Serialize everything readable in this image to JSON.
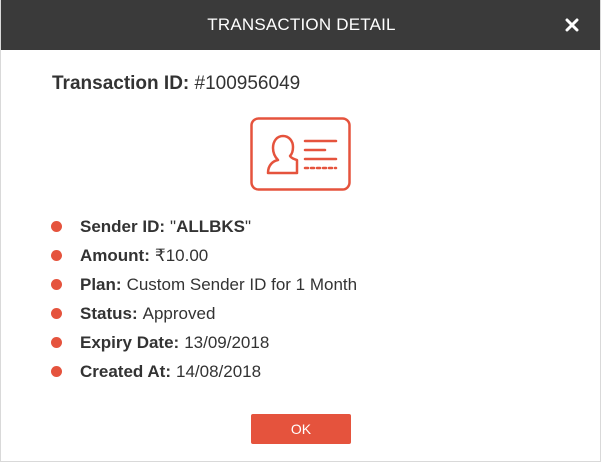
{
  "header": {
    "title": "TRANSACTION DETAIL",
    "close_icon": "close-icon"
  },
  "transaction": {
    "id_label": "Transaction ID:",
    "id_value": "#100956049"
  },
  "illustration": {
    "icon": "id-card-icon",
    "color": "#e5533d"
  },
  "details": [
    {
      "label": "Sender ID:",
      "value_prefix": "\"",
      "value_bold": "ALLBKS",
      "value_suffix": "\""
    },
    {
      "label": "Amount:",
      "value": "₹10.00"
    },
    {
      "label": "Plan:",
      "value": "Custom Sender ID for 1 Month"
    },
    {
      "label": "Status:",
      "value": "Approved"
    },
    {
      "label": "Expiry Date:",
      "value": "13/09/2018"
    },
    {
      "label": "Created At:",
      "value": "14/08/2018"
    }
  ],
  "footer": {
    "ok_label": "OK"
  },
  "colors": {
    "header_bg": "#3a3a3a",
    "accent": "#e5533d",
    "text": "#333333"
  }
}
